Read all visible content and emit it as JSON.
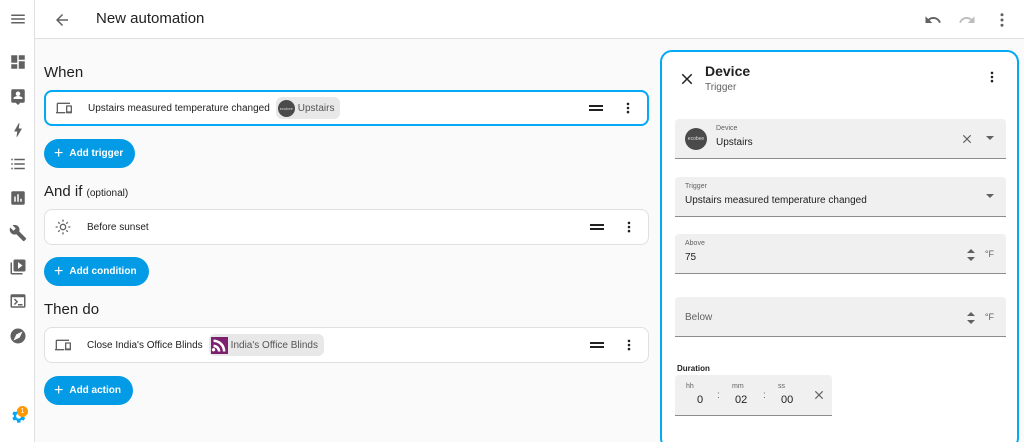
{
  "topbar": {
    "title": "New automation"
  },
  "sidebar": {
    "items": [
      {
        "name": "menu-icon"
      },
      {
        "name": "dashboard-icon"
      },
      {
        "name": "logbook-icon"
      },
      {
        "name": "energy-icon"
      },
      {
        "name": "list-icon"
      },
      {
        "name": "history-icon"
      },
      {
        "name": "wrench-icon"
      },
      {
        "name": "media-icon"
      },
      {
        "name": "terminal-icon"
      },
      {
        "name": "compass-icon"
      },
      {
        "name": "settings-icon"
      }
    ],
    "badge": "1"
  },
  "when": {
    "heading": "When",
    "trigger": {
      "text": "Upstairs measured temperature changed",
      "chip_label": "Upstairs",
      "chip_logo": "ecobee"
    },
    "add_label": "Add trigger"
  },
  "and_if": {
    "heading": "And if",
    "optional": "(optional)",
    "condition": {
      "text": "Before sunset"
    },
    "add_label": "Add condition"
  },
  "then_do": {
    "heading": "Then do",
    "action": {
      "text": "Close India's Office Blinds",
      "chip_label": "India's Office Blinds"
    },
    "add_label": "Add action"
  },
  "editor": {
    "title": "Device",
    "subtitle": "Trigger",
    "device": {
      "label": "Device",
      "value": "Upstairs",
      "logo": "ecobee"
    },
    "trigger": {
      "label": "Trigger",
      "value": "Upstairs measured temperature changed"
    },
    "above": {
      "label": "Above",
      "value": "75",
      "unit": "°F"
    },
    "below": {
      "placeholder": "Below",
      "unit": "°F"
    },
    "duration": {
      "label": "Duration",
      "hh_label": "hh",
      "hh": "0",
      "mm_label": "mm",
      "mm": "02",
      "ss_label": "ss",
      "ss": "00",
      "sep": ":"
    }
  },
  "colors": {
    "accent": "#03a9f4",
    "button": "#039be5",
    "badge": "#ff9800"
  }
}
